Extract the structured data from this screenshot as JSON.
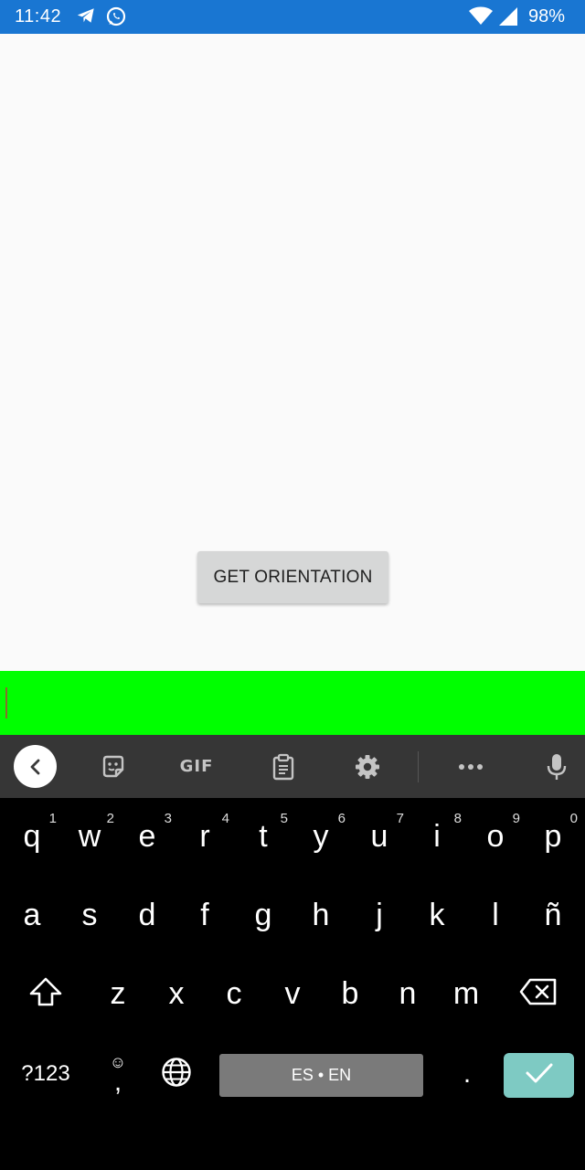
{
  "status_bar": {
    "time": "11:42",
    "battery": "98%",
    "background_color": "#1976d2",
    "icons": [
      "telegram-icon",
      "whatsapp-icon",
      "wifi-icon",
      "cell-signal-icon"
    ]
  },
  "app": {
    "background_color": "#fafafa",
    "button_label": "GET ORIENTATION"
  },
  "input": {
    "value": "",
    "background_color": "#00ff00"
  },
  "keyboard_toolbar": {
    "icons": [
      "back-chevron-icon",
      "sticker-icon",
      "gif-icon",
      "clipboard-icon",
      "settings-icon",
      "more-icon",
      "microphone-icon"
    ],
    "gif_label": "GIF"
  },
  "keyboard": {
    "row1": [
      {
        "key": "q",
        "hint": "1"
      },
      {
        "key": "w",
        "hint": "2"
      },
      {
        "key": "e",
        "hint": "3"
      },
      {
        "key": "r",
        "hint": "4"
      },
      {
        "key": "t",
        "hint": "5"
      },
      {
        "key": "y",
        "hint": "6"
      },
      {
        "key": "u",
        "hint": "7"
      },
      {
        "key": "i",
        "hint": "8"
      },
      {
        "key": "o",
        "hint": "9"
      },
      {
        "key": "p",
        "hint": "0"
      }
    ],
    "row2": [
      "a",
      "s",
      "d",
      "f",
      "g",
      "h",
      "j",
      "k",
      "l",
      "ñ"
    ],
    "row3": [
      "z",
      "x",
      "c",
      "v",
      "b",
      "n",
      "m"
    ],
    "symbols_label": "?123",
    "comma": ",",
    "comma_hint": "☺",
    "space_label": "ES • EN",
    "period": ".",
    "enter_color": "#7ecac3"
  }
}
